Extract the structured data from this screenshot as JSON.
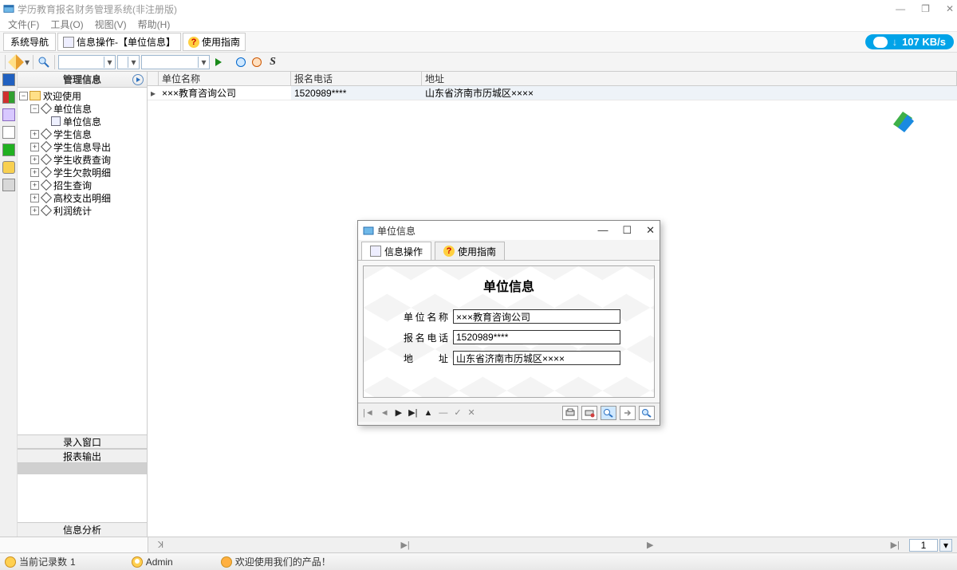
{
  "app": {
    "title": "学历教育报名财务管理系统(非注册版)"
  },
  "menu": {
    "file": "文件(F)",
    "tools": "工具(O)",
    "view": "视图(V)",
    "help": "帮助(H)"
  },
  "top_tabs": {
    "nav": "系统导航",
    "info_op": "信息操作-【单位信息】",
    "guide": "使用指南"
  },
  "netspeed": {
    "value": "107 KB/s"
  },
  "nav": {
    "header": "管理信息",
    "root": "欢迎使用",
    "items": [
      {
        "label": "单位信息",
        "children": [
          {
            "label": "单位信息"
          }
        ]
      },
      {
        "label": "学生信息"
      },
      {
        "label": "学生信息导出"
      },
      {
        "label": "学生收费查询"
      },
      {
        "label": "学生欠款明细"
      },
      {
        "label": "招生查询"
      },
      {
        "label": "高校支出明细"
      },
      {
        "label": "利润统计"
      }
    ],
    "sections": {
      "entry": "录入窗口",
      "report": "报表输出",
      "analysis": "信息分析"
    }
  },
  "grid": {
    "cols": {
      "name": "单位名称",
      "phone": "报名电话",
      "addr": "地址"
    },
    "rows": [
      {
        "name": "×××教育咨询公司",
        "phone": "1520989****",
        "addr": "山东省济南市历城区××××"
      }
    ]
  },
  "dlg": {
    "title": "单位信息",
    "tabs": {
      "info_op": "信息操作",
      "guide": "使用指南"
    },
    "form": {
      "title": "单位信息",
      "labels": {
        "name": "单位名称",
        "phone": "报名电话",
        "addr": "地　　址"
      },
      "values": {
        "name": "×××教育咨询公司",
        "phone": "1520989****",
        "addr": "山东省济南市历城区××××"
      }
    }
  },
  "hscroll": {
    "page": "1"
  },
  "status": {
    "records_label": "当前记录数",
    "records_value": "1",
    "user": "Admin",
    "welcome": "欢迎使用我们的产品！"
  }
}
